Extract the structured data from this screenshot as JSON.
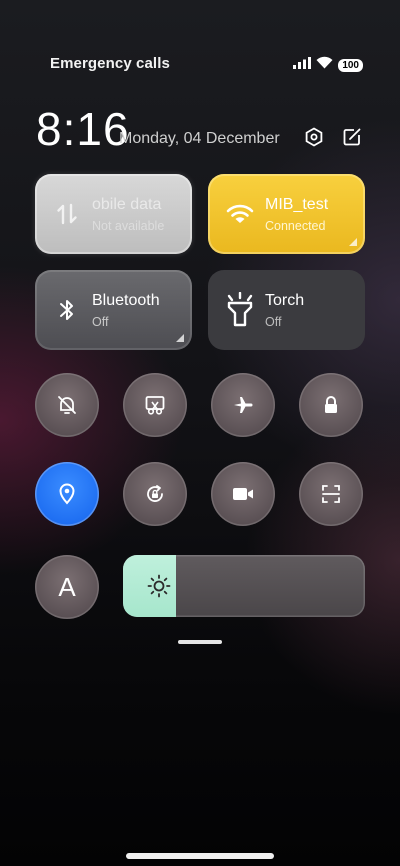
{
  "status_bar": {
    "carrier_text": "Emergency calls",
    "battery": "100",
    "icons": [
      "signal-icon",
      "wifi-icon",
      "battery-icon"
    ]
  },
  "header": {
    "time": "8:16",
    "date": "Monday, 04 December",
    "icons": [
      "settings-icon",
      "edit-icon"
    ]
  },
  "tiles": {
    "mobile_data": {
      "title": "Mobile data",
      "title_visible": "obile data",
      "subtitle": "Not available",
      "state": "unavailable",
      "icon": "mobile-data-icon"
    },
    "wifi": {
      "title": "MIB_test",
      "subtitle": "Connected",
      "state": "on",
      "icon": "wifi-icon",
      "color": "#f3c530"
    },
    "bluetooth": {
      "title": "Bluetooth",
      "subtitle": "Off",
      "state": "off",
      "icon": "bluetooth-icon"
    },
    "torch": {
      "title": "Torch",
      "subtitle": "Off",
      "state": "off",
      "icon": "flashlight-icon"
    }
  },
  "toggles": [
    {
      "name": "mute",
      "icon": "bell-off-icon",
      "state": "off"
    },
    {
      "name": "screenshot",
      "icon": "scissors-icon",
      "state": "off"
    },
    {
      "name": "airplane-mode",
      "icon": "airplane-icon",
      "state": "off"
    },
    {
      "name": "lock-screen",
      "icon": "lock-icon",
      "state": "off"
    },
    {
      "name": "location",
      "icon": "location-pin-icon",
      "state": "on",
      "color": "#2277f4"
    },
    {
      "name": "rotation-lock",
      "icon": "rotation-lock-icon",
      "state": "off"
    },
    {
      "name": "screen-recorder",
      "icon": "video-camera-icon",
      "state": "off"
    },
    {
      "name": "scanner",
      "icon": "scan-icon",
      "state": "off"
    }
  ],
  "font_button": {
    "label": "A"
  },
  "brightness": {
    "level": 0.22,
    "icon": "sun-icon",
    "color": "#b5ecd6"
  }
}
